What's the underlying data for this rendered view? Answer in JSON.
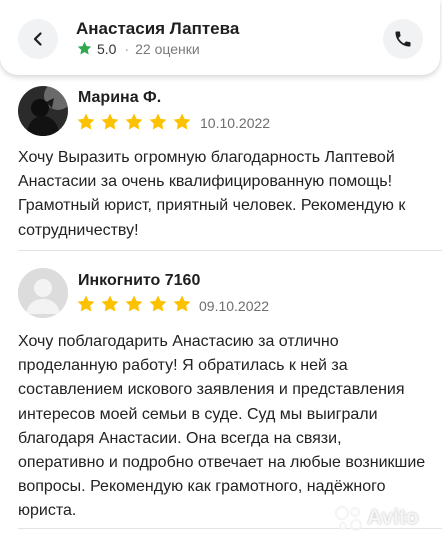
{
  "header": {
    "name": "Анастасия Лаптева",
    "rating": "5.0",
    "separator": "·",
    "reviews_count": "22 оценки",
    "icons": {
      "back": "chevron-left-icon",
      "call": "phone-icon",
      "rating_star": "star-icon"
    }
  },
  "colors": {
    "star": "#fcc200",
    "green_star": "#2fa84f",
    "avatar_placeholder": "#dcdcdc"
  },
  "reviews": [
    {
      "author": "Марина Ф.",
      "stars": 5,
      "date": "10.10.2022",
      "text": "Хочу Выразить огромную благодарность Лаптевой Анастасии за очень квалифицированную помощь! Грамотный юрист, приятный человек. Рекомендую к сотрудничеству!"
    },
    {
      "author": "Инкогнито 7160",
      "stars": 5,
      "date": "09.10.2022",
      "text": "Хочу поблагодарить Анастасию за отлично проделанную работу! Я обратилась к ней за составлением искового заявления и представления интересов моей семьи в суде. Суд мы выиграли благодаря Анастасии. Она всегда на связи, оперативно и подробно отвечает на любые возникшие вопросы. Рекомендую как грамотного, надёжного юриста."
    }
  ],
  "watermark": "Avito"
}
